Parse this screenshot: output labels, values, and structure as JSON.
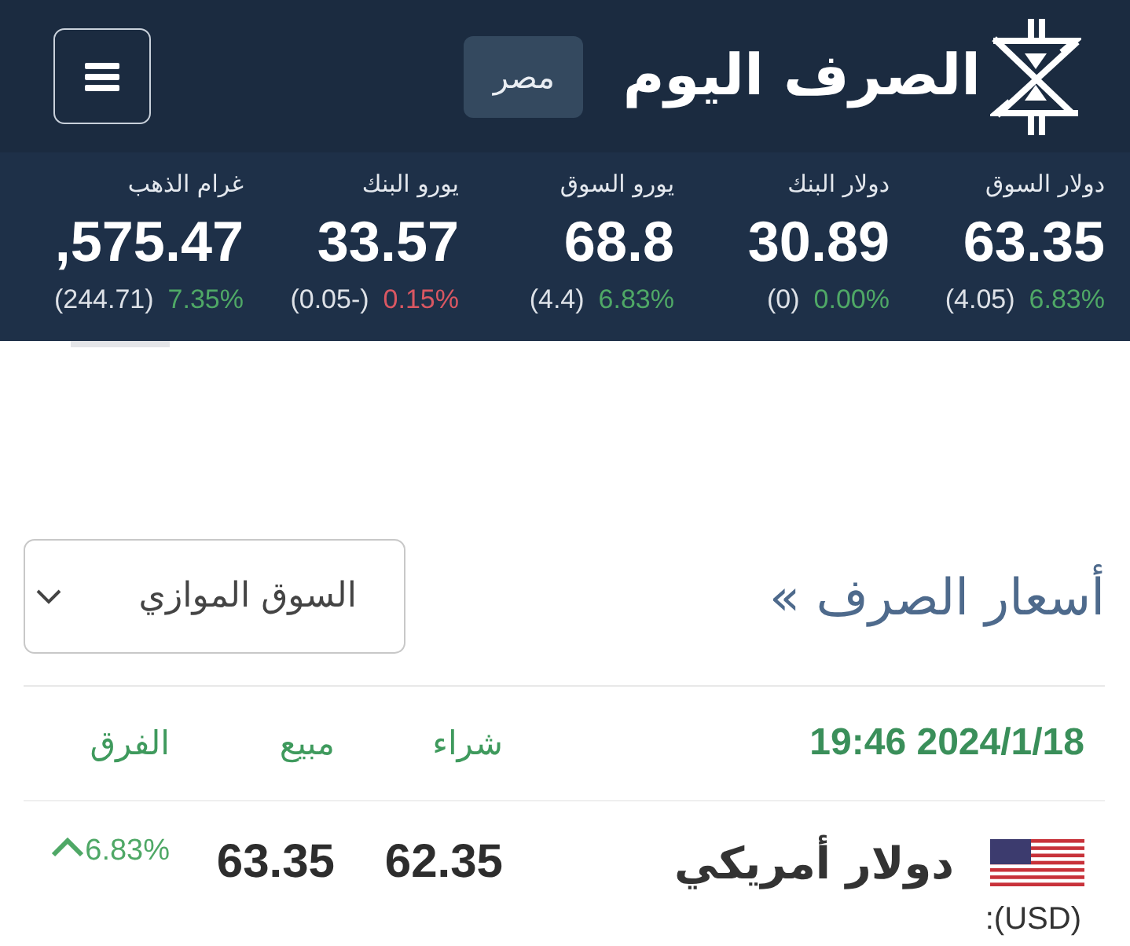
{
  "header": {
    "logo_text": "الصرف اليوم",
    "country_button": "مصر"
  },
  "ticker": [
    {
      "label": "دولار السوق",
      "value": "63.35",
      "change": "(4.05)",
      "percent": "6.83%",
      "kind": "gain"
    },
    {
      "label": "دولار البنك",
      "value": "30.89",
      "change": "(0)",
      "percent": "0.00%",
      "kind": "gain"
    },
    {
      "label": "يورو السوق",
      "value": "68.8",
      "change": "(4.4)",
      "percent": "6.83%",
      "kind": "gain"
    },
    {
      "label": "يورو البنك",
      "value": "33.57",
      "change": "(0.05-)",
      "percent": "0.15%",
      "kind": "loss"
    },
    {
      "label": "غرام الذهب",
      "value": ",575.47",
      "change": "(244.71)",
      "percent": "7.35%",
      "kind": "gain"
    }
  ],
  "section": {
    "title": "أسعار الصرف »",
    "market_select": {
      "value": "السوق الموازي"
    }
  },
  "table": {
    "timestamp": "2024/1/18 19:46",
    "columns": [
      "شراء",
      "مبيع",
      "الفرق"
    ],
    "rows": [
      {
        "currency": "دولار أمريكي",
        "code": "(USD):",
        "buy": "62.35",
        "sell": "63.35",
        "change": "6.83%",
        "kind": "gain"
      }
    ]
  }
}
